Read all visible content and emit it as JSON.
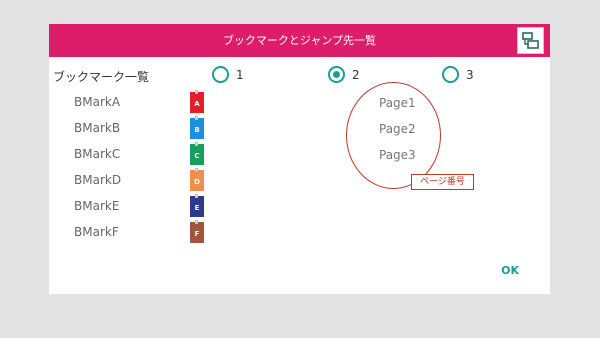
{
  "dialog": {
    "title": "ブックマークとジャンプ先一覧",
    "title_button_icon": "split-view-icon",
    "header_label": "ブックマーク一覧",
    "radios": [
      {
        "label": "1",
        "checked": false
      },
      {
        "label": "2",
        "checked": true
      },
      {
        "label": "3",
        "checked": false
      }
    ],
    "bookmarks": [
      {
        "name": "BMarkA",
        "letter": "A",
        "color": "#e2202c"
      },
      {
        "name": "BMarkB",
        "letter": "B",
        "color": "#1c8fe0"
      },
      {
        "name": "BMarkC",
        "letter": "C",
        "color": "#17a05a"
      },
      {
        "name": "BMarkD",
        "letter": "D",
        "color": "#ef8f4a"
      },
      {
        "name": "BMarkE",
        "letter": "E",
        "color": "#2e3a8c"
      },
      {
        "name": "BMarkF",
        "letter": "F",
        "color": "#a0553c"
      }
    ],
    "pages": [
      "Page1",
      "Page2",
      "Page3"
    ],
    "annotation_label": "ページ番号",
    "ok_label": "OK"
  },
  "colors": {
    "title_bar": "#dd1d69",
    "accent": "#1a9d96",
    "annotation": "#c0392b"
  }
}
